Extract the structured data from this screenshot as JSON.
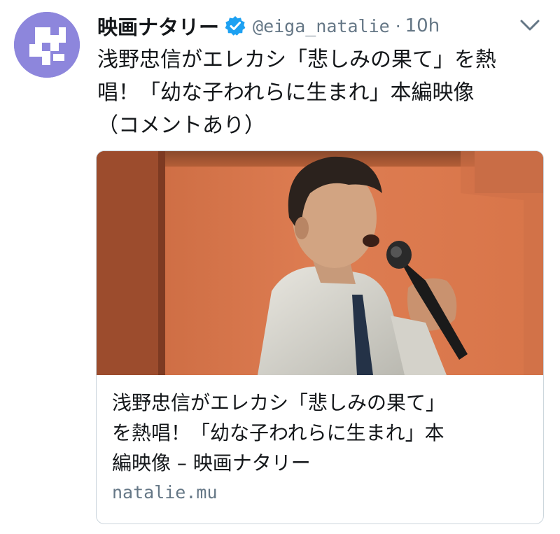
{
  "account": {
    "display_name": "映画ナタリー",
    "handle": "@eiga_natalie",
    "separator": "·",
    "timestamp": "10h",
    "verified": true,
    "avatar_icon": "natalie-logo-icon",
    "avatar_color": "#8d86dc"
  },
  "tweet": {
    "text_lines": [
      "浅野忠信がエレカシ「悲しみの果て」を熱",
      "唱！「幼な子われらに生まれ」本編映像",
      "（コメントあり）"
    ]
  },
  "card": {
    "image_icon": "man-singing-into-microphone-photo",
    "title_lines": [
      "浅野忠信がエレカシ「悲しみの果て」",
      "を熱唱！「幼な子われらに生まれ」本",
      "編映像 – 映画ナタリー"
    ],
    "domain": "natalie.mu"
  },
  "colors": {
    "text_primary": "#14171a",
    "text_secondary": "#657786",
    "verified_blue": "#1da1f2",
    "card_border": "#ccd6dd",
    "photo_wall_orange": "#d9774c"
  },
  "menu": {
    "caret_icon": "chevron-down-icon"
  }
}
